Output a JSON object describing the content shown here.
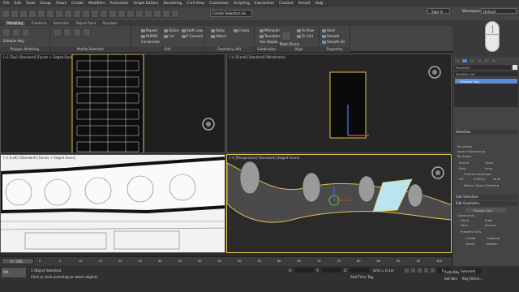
{
  "menu": [
    "File",
    "Edit",
    "Tools",
    "Group",
    "Views",
    "Create",
    "Modifiers",
    "Animation",
    "Graph Editors",
    "Rendering",
    "Civil View",
    "Customize",
    "Scripting",
    "Interactive",
    "Content",
    "Arnold",
    "Help"
  ],
  "signin": "Sign In",
  "workspaces_label": "Workspaces:",
  "workspaces_value": "Default",
  "selection_set": "Create Selection Se",
  "ribbon_tabs": [
    "Modeling",
    "Freeform",
    "Selection",
    "Object Paint",
    "Populate"
  ],
  "ribbon": {
    "polygon_modeling": "Polygon Modeling",
    "editable_poly": "Editable Poly",
    "modify_selection": "Modify Selection",
    "edit": "Edit",
    "geometry_all": "Geometry (All)",
    "subdivision": "Subdivision",
    "align": "Align",
    "properties": "Properties",
    "items": {
      "repeat": "Repeat",
      "quickslice": "QSlice",
      "swiftloop": "Swift Loop",
      "relax": "Relax",
      "create": "Create",
      "msmooth": "MSmooth",
      "toview": "To View",
      "hard": "Hard",
      "nurms": "NURMS",
      "cut": "Cut",
      "pconnect": "P Connect",
      "attach": "Attach",
      "tessellate": "Tessellate",
      "make_planar": "Make Planar",
      "togrid": "To Grid",
      "smooth": "Smooth",
      "constraints": "Constraints",
      "use_displace": "Use Displac...",
      "smooth30": "Smooth 30"
    }
  },
  "viewports": {
    "top": "[+] [Top] [Standard] [Facets + Edged Faces]",
    "front": "[+] [Front] [Standard] [Wireframe]",
    "left": "[+] [Left] [Standard] [Facets + Edged Faces]",
    "persp": "[+] [Perspective] [Standard] [Edged Faces]"
  },
  "cmd": {
    "object_name": "Plane002",
    "modifier_list": "Modifier List",
    "stack_item": "Editable Poly",
    "selection_hdr": "Selection",
    "by_vertex": "By Vertex",
    "ignore_backfacing": "Ignore Backfacing",
    "by_angle": "By Angle:",
    "shrink": "Shrink",
    "grow": "Grow",
    "ring": "Ring",
    "loop": "Loop",
    "preview_selection": "Preview Selection",
    "off": "Off",
    "subobj": "SubObj",
    "multi": "Multi",
    "whole_object_selected": "Whole Object Selected",
    "soft_selection": "Soft Selection",
    "edit_geometry": "Edit Geometry",
    "repeat_last": "Repeat Last",
    "constraints": "Constraints",
    "none": "None",
    "edge": "Edge",
    "face": "Face",
    "normal": "Normal",
    "preserve_uvs": "Preserve UVs",
    "create": "Create",
    "collapse": "Collapse",
    "attach": "Attach",
    "detach": "Detach"
  },
  "timeline": {
    "frame": "0 / 100",
    "ticks": [
      "0",
      "5",
      "10",
      "15",
      "20",
      "25",
      "30",
      "35",
      "40",
      "45",
      "50",
      "55",
      "60",
      "65",
      "70",
      "75",
      "80",
      "85",
      "90",
      "95",
      "100"
    ]
  },
  "status": {
    "maxscript": "MA",
    "objects_selected": "1 Object Selected",
    "prompt": "Click or click-and-drag to select objects",
    "x_label": "X:",
    "x_val": "",
    "y_label": "Y:",
    "y_val": "",
    "z_label": "Z:",
    "z_val": "",
    "grid": "Grid = 0,1m",
    "add_time_tag": "Add Time Tag",
    "auto_key": "Auto Key",
    "selected": "Selected",
    "set_key": "Set Key",
    "key_filters": "Key Filters...",
    "frame_field": "0"
  },
  "colors": {
    "accent": "#e2c34a",
    "selection_blue": "#5b8dd6",
    "viewport_dark": "#232323",
    "viewport_white": "#f2f2f2"
  }
}
